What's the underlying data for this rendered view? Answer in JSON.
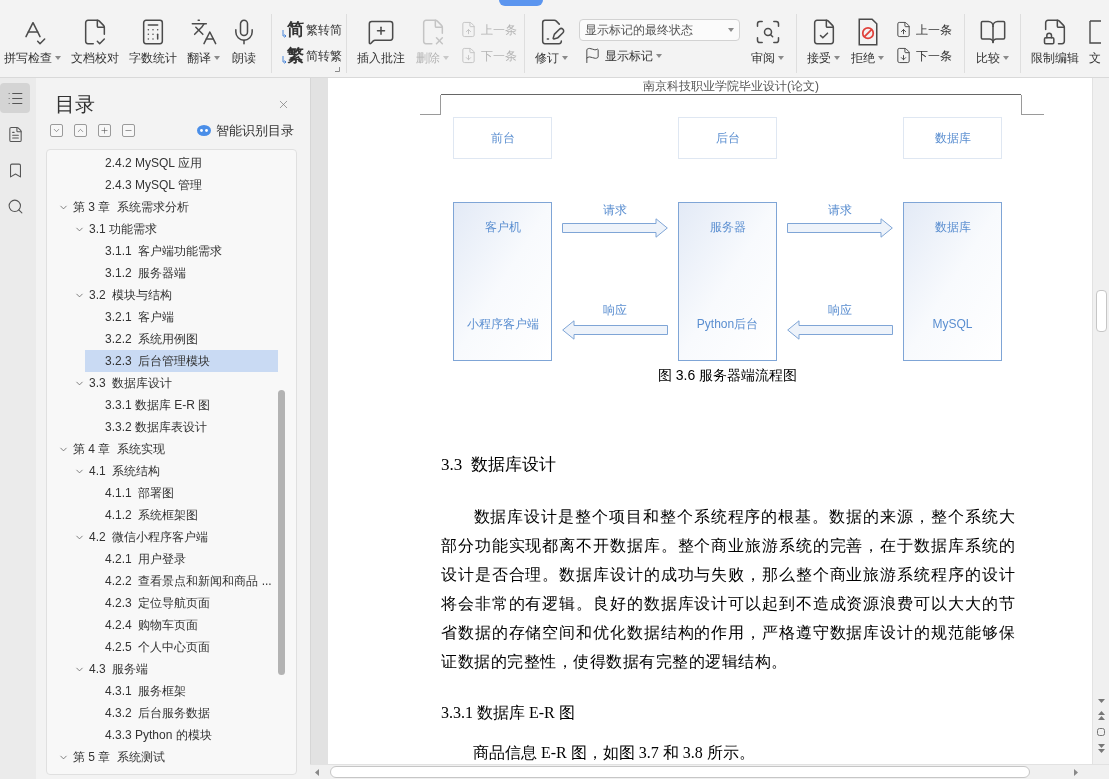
{
  "ribbon": {
    "groups": [
      {
        "items": [
          {
            "kind": "large",
            "label": "拼写检查",
            "dropdown": true,
            "disabled": false
          },
          {
            "kind": "large",
            "label": "文档校对",
            "disabled": false
          },
          {
            "kind": "large",
            "label": "字数统计",
            "disabled": false
          },
          {
            "kind": "large",
            "label": "翻译",
            "dropdown": true,
            "disabled": false
          },
          {
            "kind": "large",
            "label": "朗读",
            "disabled": false
          }
        ]
      },
      {
        "launcher": true,
        "items": [
          {
            "kind": "stack",
            "rows": [
              {
                "kind": "glyph",
                "glyph": "简",
                "label": "繁转简",
                "disabled": false
              },
              {
                "kind": "glyph",
                "glyph": "繁",
                "label": "简转繁",
                "disabled": false
              }
            ]
          }
        ]
      },
      {
        "items": [
          {
            "kind": "large",
            "label": "插入批注",
            "disabled": false
          },
          {
            "kind": "large",
            "label": "删除",
            "dropdown": true,
            "disabled": true
          },
          {
            "kind": "stack",
            "rows": [
              {
                "kind": "icon",
                "label": "上一条",
                "disabled": true
              },
              {
                "kind": "icon",
                "label": "下一条",
                "disabled": true
              }
            ]
          }
        ]
      },
      {
        "items": [
          {
            "kind": "large",
            "label": "修订",
            "dropdown": true,
            "disabled": false
          },
          {
            "kind": "stack",
            "rows": [
              {
                "kind": "select",
                "value": "显示标记的最终状态"
              },
              {
                "kind": "icon",
                "label": "显示标记",
                "dropdown": true,
                "disabled": false
              }
            ]
          },
          {
            "kind": "large",
            "label": "审阅",
            "dropdown": true,
            "disabled": false
          }
        ]
      },
      {
        "items": [
          {
            "kind": "large",
            "label": "接受",
            "dropdown": true,
            "disabled": false
          },
          {
            "kind": "large",
            "label": "拒绝",
            "dropdown": true,
            "disabled": false
          },
          {
            "kind": "stack",
            "rows": [
              {
                "kind": "icon",
                "label": "上一条",
                "disabled": false
              },
              {
                "kind": "icon",
                "label": "下一条",
                "disabled": false
              }
            ]
          }
        ]
      },
      {
        "items": [
          {
            "kind": "large",
            "label": "比较",
            "dropdown": true,
            "disabled": false
          }
        ]
      },
      {
        "items": [
          {
            "kind": "large",
            "label": "限制编辑",
            "disabled": false
          },
          {
            "kind": "large",
            "label": "文",
            "disabled": false
          }
        ]
      }
    ]
  },
  "rail": [
    {
      "selected": true
    },
    {
      "selected": false
    },
    {
      "selected": false
    },
    {
      "selected": false
    }
  ],
  "toc": {
    "title": "目录",
    "smart_button": "智能识别目录",
    "items": [
      {
        "children": [
          {
            "children": [
              {
                "label": "2.4.2 MySQL 应用",
                "selected": false
              },
              {
                "label": "2.4.3 MySQL 管理",
                "selected": false
              }
            ]
          }
        ]
      },
      {
        "label": "第 3 章  系统需求分析",
        "expanded": true,
        "selected": false,
        "children": [
          {
            "label": "3.1 功能需求",
            "expanded": true,
            "selected": false,
            "children": [
              {
                "label": "3.1.1  客户端功能需求",
                "selected": false
              },
              {
                "label": "3.1.2  服务器端",
                "selected": false
              }
            ]
          },
          {
            "label": "3.2  模块与结构",
            "expanded": true,
            "selected": false,
            "children": [
              {
                "label": "3.2.1  客户端",
                "selected": false
              },
              {
                "label": "3.2.2  系统用例图",
                "selected": false
              },
              {
                "label": "3.2.3  后台管理模块",
                "selected": true
              }
            ]
          },
          {
            "label": "3.3  数据库设计",
            "expanded": true,
            "selected": false,
            "children": [
              {
                "label": "3.3.1 数据库 E-R 图",
                "selected": false
              },
              {
                "label": "3.3.2 数据库表设计",
                "selected": false
              }
            ]
          }
        ]
      },
      {
        "label": "第 4 章  系统实现",
        "expanded": true,
        "selected": false,
        "children": [
          {
            "label": "4.1  系统结构",
            "expanded": true,
            "selected": false,
            "children": [
              {
                "label": "4.1.1  部署图",
                "selected": false
              },
              {
                "label": "4.1.2  系统框架图",
                "selected": false
              }
            ]
          },
          {
            "label": "4.2  微信小程序客户端",
            "expanded": true,
            "selected": false,
            "children": [
              {
                "label": "4.2.1  用户登录",
                "selected": false
              },
              {
                "label": "4.2.2  查看景点和新闻和商品 ...",
                "selected": false
              },
              {
                "label": "4.2.3  定位导航页面",
                "selected": false
              },
              {
                "label": "4.2.4  购物车页面",
                "selected": false
              },
              {
                "label": "4.2.5  个人中心页面",
                "selected": false
              }
            ]
          },
          {
            "label": "4.3  服务端",
            "expanded": true,
            "selected": false,
            "children": [
              {
                "label": "4.3.1  服务框架",
                "selected": false
              },
              {
                "label": "4.3.2  后台服务数据",
                "selected": false
              },
              {
                "label": "4.3.3 Python 的模块",
                "selected": false
              }
            ]
          }
        ]
      },
      {
        "label": "第 5 章  系统测试",
        "expanded": true,
        "selected": false
      }
    ]
  },
  "document": {
    "header": "南京科技职业学院毕业设计(论文)",
    "figure": {
      "columns": [
        {
          "header": "前台",
          "title": "客户机",
          "subtitle": "小程序客户端"
        },
        {
          "header": "后台",
          "title": "服务器",
          "subtitle": "Python后台"
        },
        {
          "header": "数据库",
          "title": "数据库",
          "subtitle": "MySQL"
        }
      ],
      "connectors": [
        {
          "request": "请求",
          "response": "响应"
        },
        {
          "request": "请求",
          "response": "响应"
        }
      ],
      "caption": "图 3.6 服务器端流程图"
    },
    "content": [
      {
        "kind": "heading",
        "text": "3.3  数据库设计"
      },
      {
        "kind": "paragraph",
        "text": "数据库设计是整个项目和整个系统程序的根基。数据的来源，整个系统大部分功能实现都离不开数据库。整个商业旅游系统的完善，在于数据库系统的设计是否合理。数据库设计的成功与失败，那么整个商业旅游系统程序的设计将会非常的有逻辑。良好的数据库设计可以起到不造成资源浪费可以大大的节省数据的存储空间和优化数据结构的作用，严格遵守数据库设计的规范能够保证数据的完整性，使得数据有完整的逻辑结构。"
      },
      {
        "kind": "subheading",
        "text": "3.3.1 数据库 E-R 图"
      },
      {
        "kind": "indented",
        "text": "商品信息 E-R 图，如图 3.7 和 3.8 所示。"
      }
    ]
  }
}
